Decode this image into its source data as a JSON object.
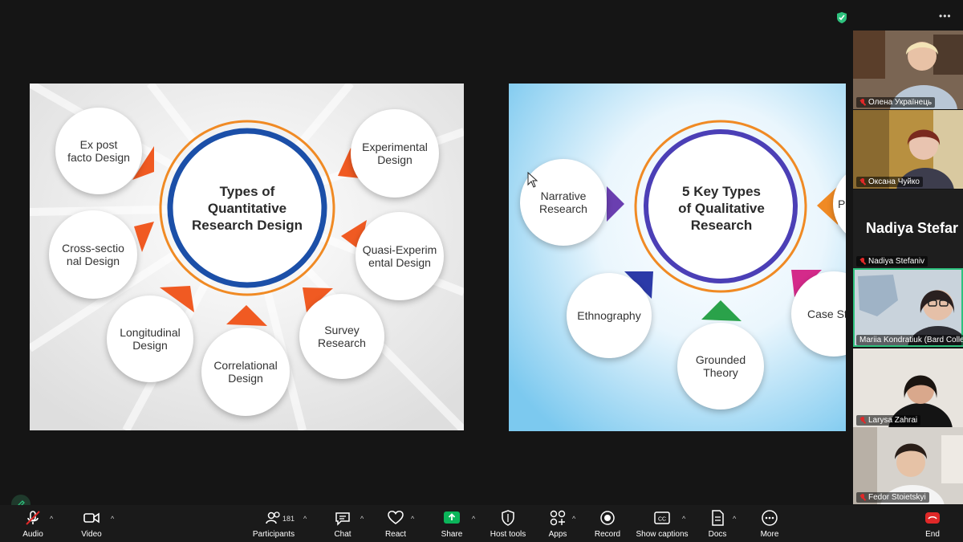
{
  "left_slide": {
    "title_lines": [
      "Types of",
      "Quantitative",
      "Research Design"
    ],
    "items": [
      "Ex post\nfacto Design",
      "Experimental\nDesign",
      "Cross-sectio\nnal Design",
      "Quasi-Experim\nental Design",
      "Longitudinal\nDesign",
      "Correlational\nDesign",
      "Survey\nResearch"
    ]
  },
  "right_slide": {
    "title_lines": [
      "5 Key Types",
      "of Qualitative",
      "Research"
    ],
    "items": [
      "Narrative\nResearch",
      "Ethnography",
      "Grounded\nTheory",
      "Case St",
      "P"
    ]
  },
  "gallery": {
    "participants": [
      {
        "name": "Олена Українець"
      },
      {
        "name": "Оксана Чуйко"
      },
      {
        "name": "Nadiya Stefaniv",
        "display_name": "Nadiya Stefar"
      },
      {
        "name": "Mariia Kondratiuk (Bard College"
      },
      {
        "name": "Larysa Zahrai"
      },
      {
        "name": "Fedor Stoietskyi"
      }
    ]
  },
  "toolbar": {
    "audio": "Audio",
    "video": "Video",
    "participants": "Participants",
    "participant_count": "181",
    "chat": "Chat",
    "react": "React",
    "share": "Share",
    "host_tools": "Host tools",
    "apps": "Apps",
    "record": "Record",
    "show_captions": "Show captions",
    "docs": "Docs",
    "more": "More",
    "end": "End"
  },
  "colors": {
    "share_green": "#0bb55a",
    "end_red": "#e02828",
    "active_speaker": "#2ec27e",
    "ring_orange": "#f08a24",
    "ring_blue": "#1b4fa8",
    "ring_purple": "#4b3fb6"
  }
}
